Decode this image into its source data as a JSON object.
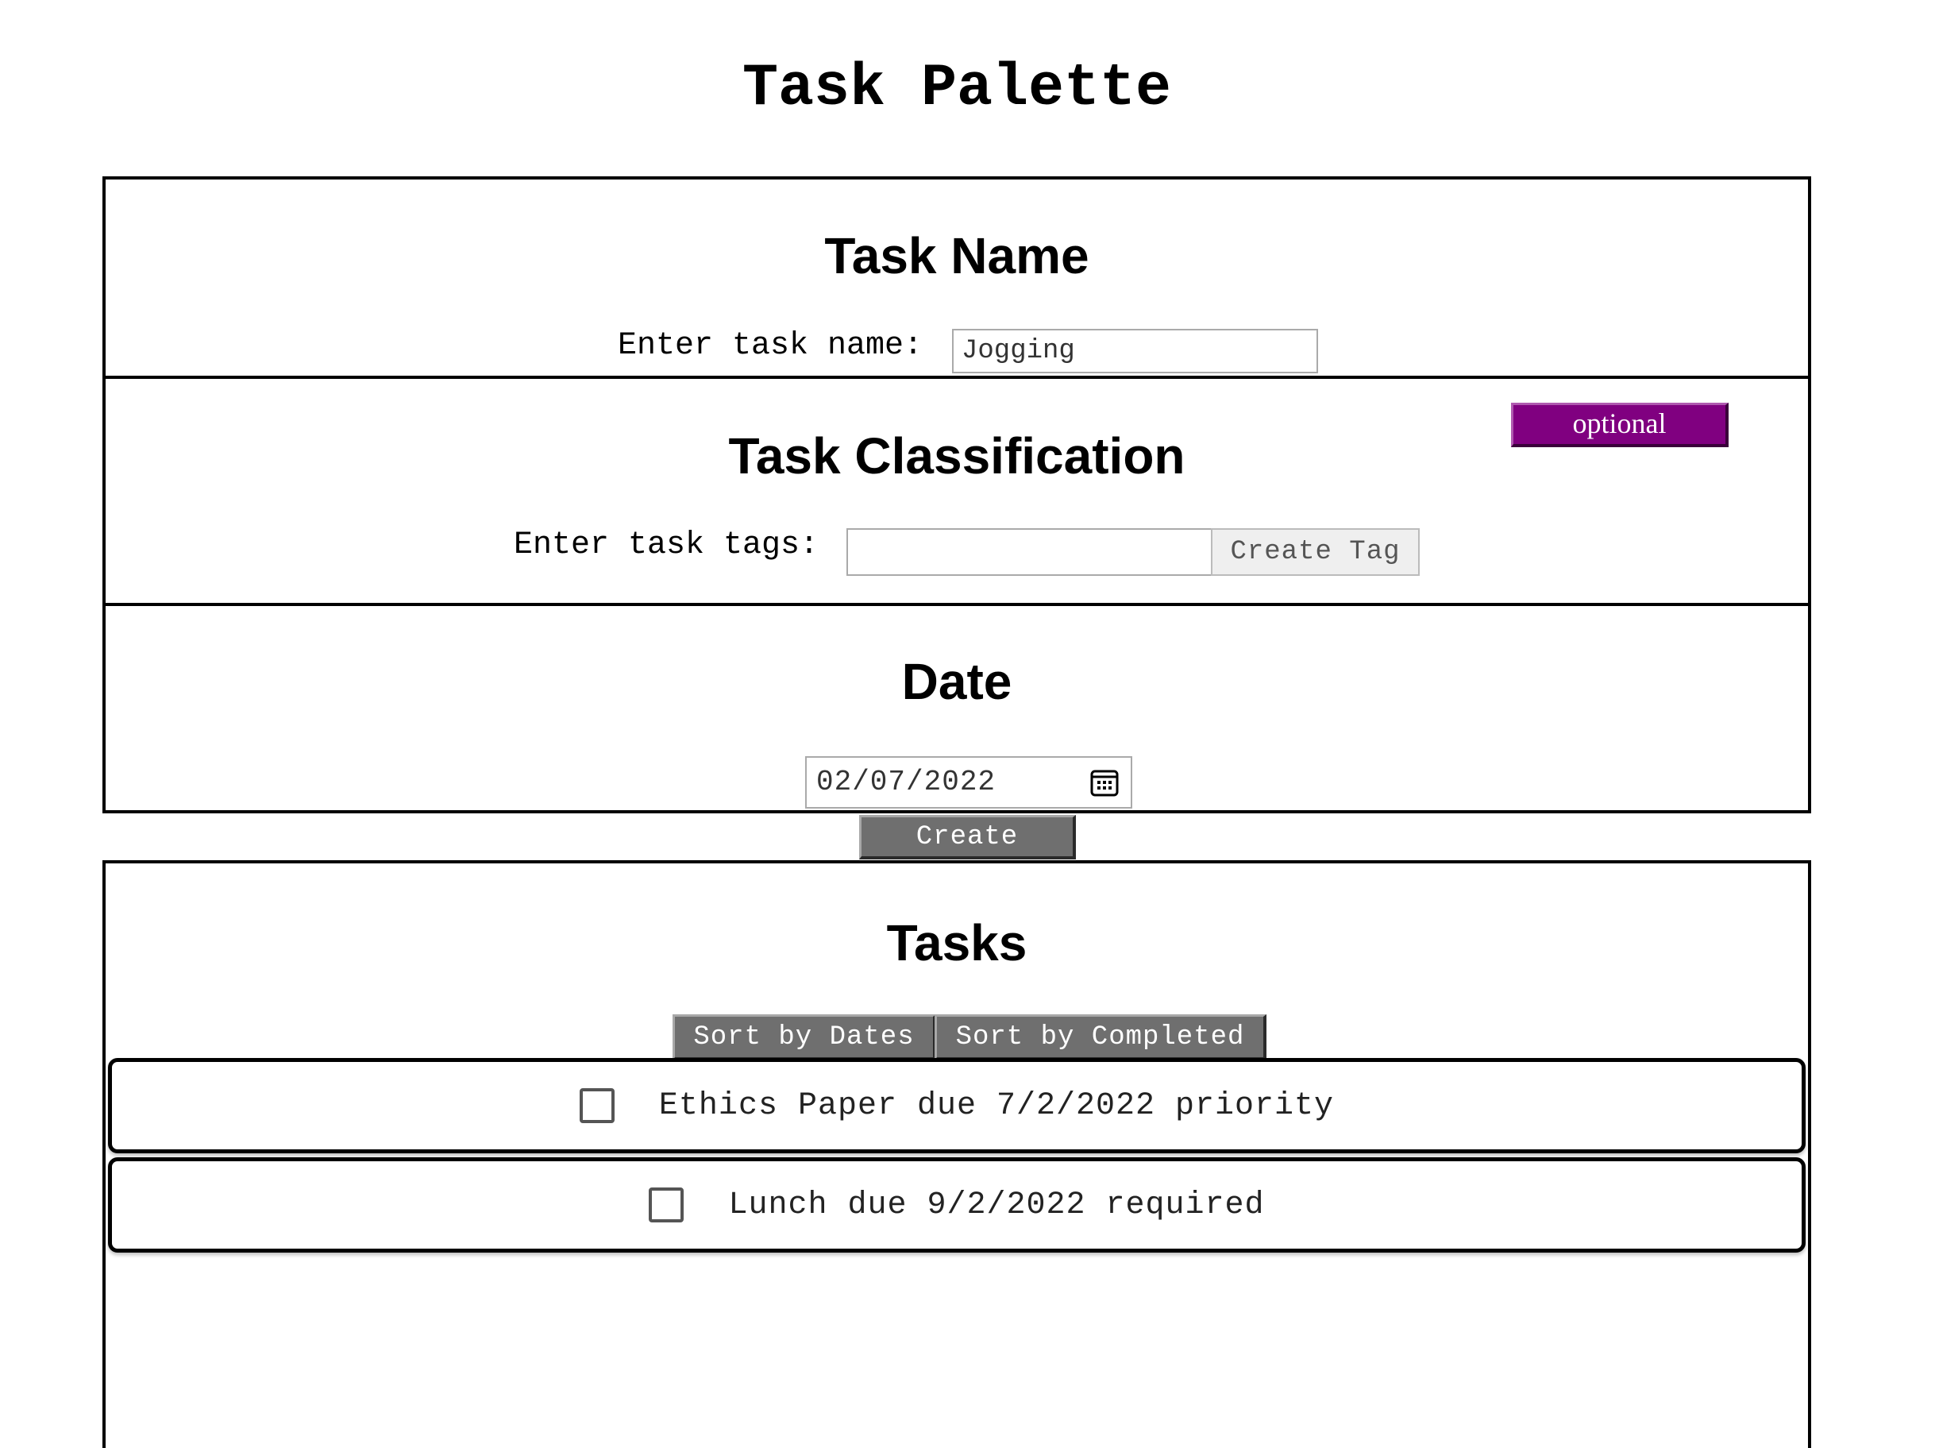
{
  "app": {
    "title": "Task Palette"
  },
  "task_name_section": {
    "heading": "Task Name",
    "label": "Enter task name:",
    "input_value": "Jogging"
  },
  "classification_section": {
    "heading": "Task Classification",
    "badge": "optional",
    "badge_color": "#800080",
    "label": "Enter task tags:",
    "input_value": "",
    "create_tag_label": "Create Tag"
  },
  "date_section": {
    "heading": "Date",
    "date_value": "02/07/2022",
    "icon": "calendar-icon"
  },
  "create_button": {
    "label": "Create"
  },
  "tasks_section": {
    "heading": "Tasks",
    "sort_dates_label": "Sort by Dates",
    "sort_completed_label": "Sort by Completed",
    "items": [
      {
        "text": "Ethics Paper due 7/2/2022 priority",
        "checked": false
      },
      {
        "text": "Lunch due 9/2/2022 required",
        "checked": false
      }
    ]
  },
  "colors": {
    "button_gray": "#6f6f6f",
    "badge_purple": "#800080",
    "border": "#000000"
  }
}
